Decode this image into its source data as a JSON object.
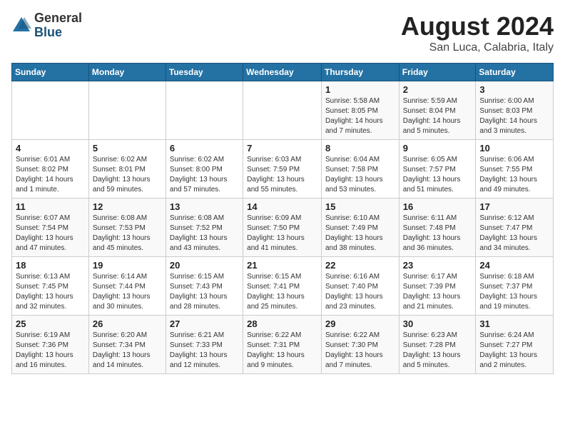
{
  "logo": {
    "general": "General",
    "blue": "Blue"
  },
  "title": "August 2024",
  "subtitle": "San Luca, Calabria, Italy",
  "days_of_week": [
    "Sunday",
    "Monday",
    "Tuesday",
    "Wednesday",
    "Thursday",
    "Friday",
    "Saturday"
  ],
  "weeks": [
    [
      {
        "day": "",
        "info": ""
      },
      {
        "day": "",
        "info": ""
      },
      {
        "day": "",
        "info": ""
      },
      {
        "day": "",
        "info": ""
      },
      {
        "day": "1",
        "info": "Sunrise: 5:58 AM\nSunset: 8:05 PM\nDaylight: 14 hours and 7 minutes."
      },
      {
        "day": "2",
        "info": "Sunrise: 5:59 AM\nSunset: 8:04 PM\nDaylight: 14 hours and 5 minutes."
      },
      {
        "day": "3",
        "info": "Sunrise: 6:00 AM\nSunset: 8:03 PM\nDaylight: 14 hours and 3 minutes."
      }
    ],
    [
      {
        "day": "4",
        "info": "Sunrise: 6:01 AM\nSunset: 8:02 PM\nDaylight: 14 hours and 1 minute."
      },
      {
        "day": "5",
        "info": "Sunrise: 6:02 AM\nSunset: 8:01 PM\nDaylight: 13 hours and 59 minutes."
      },
      {
        "day": "6",
        "info": "Sunrise: 6:02 AM\nSunset: 8:00 PM\nDaylight: 13 hours and 57 minutes."
      },
      {
        "day": "7",
        "info": "Sunrise: 6:03 AM\nSunset: 7:59 PM\nDaylight: 13 hours and 55 minutes."
      },
      {
        "day": "8",
        "info": "Sunrise: 6:04 AM\nSunset: 7:58 PM\nDaylight: 13 hours and 53 minutes."
      },
      {
        "day": "9",
        "info": "Sunrise: 6:05 AM\nSunset: 7:57 PM\nDaylight: 13 hours and 51 minutes."
      },
      {
        "day": "10",
        "info": "Sunrise: 6:06 AM\nSunset: 7:55 PM\nDaylight: 13 hours and 49 minutes."
      }
    ],
    [
      {
        "day": "11",
        "info": "Sunrise: 6:07 AM\nSunset: 7:54 PM\nDaylight: 13 hours and 47 minutes."
      },
      {
        "day": "12",
        "info": "Sunrise: 6:08 AM\nSunset: 7:53 PM\nDaylight: 13 hours and 45 minutes."
      },
      {
        "day": "13",
        "info": "Sunrise: 6:08 AM\nSunset: 7:52 PM\nDaylight: 13 hours and 43 minutes."
      },
      {
        "day": "14",
        "info": "Sunrise: 6:09 AM\nSunset: 7:50 PM\nDaylight: 13 hours and 41 minutes."
      },
      {
        "day": "15",
        "info": "Sunrise: 6:10 AM\nSunset: 7:49 PM\nDaylight: 13 hours and 38 minutes."
      },
      {
        "day": "16",
        "info": "Sunrise: 6:11 AM\nSunset: 7:48 PM\nDaylight: 13 hours and 36 minutes."
      },
      {
        "day": "17",
        "info": "Sunrise: 6:12 AM\nSunset: 7:47 PM\nDaylight: 13 hours and 34 minutes."
      }
    ],
    [
      {
        "day": "18",
        "info": "Sunrise: 6:13 AM\nSunset: 7:45 PM\nDaylight: 13 hours and 32 minutes."
      },
      {
        "day": "19",
        "info": "Sunrise: 6:14 AM\nSunset: 7:44 PM\nDaylight: 13 hours and 30 minutes."
      },
      {
        "day": "20",
        "info": "Sunrise: 6:15 AM\nSunset: 7:43 PM\nDaylight: 13 hours and 28 minutes."
      },
      {
        "day": "21",
        "info": "Sunrise: 6:15 AM\nSunset: 7:41 PM\nDaylight: 13 hours and 25 minutes."
      },
      {
        "day": "22",
        "info": "Sunrise: 6:16 AM\nSunset: 7:40 PM\nDaylight: 13 hours and 23 minutes."
      },
      {
        "day": "23",
        "info": "Sunrise: 6:17 AM\nSunset: 7:39 PM\nDaylight: 13 hours and 21 minutes."
      },
      {
        "day": "24",
        "info": "Sunrise: 6:18 AM\nSunset: 7:37 PM\nDaylight: 13 hours and 19 minutes."
      }
    ],
    [
      {
        "day": "25",
        "info": "Sunrise: 6:19 AM\nSunset: 7:36 PM\nDaylight: 13 hours and 16 minutes."
      },
      {
        "day": "26",
        "info": "Sunrise: 6:20 AM\nSunset: 7:34 PM\nDaylight: 13 hours and 14 minutes."
      },
      {
        "day": "27",
        "info": "Sunrise: 6:21 AM\nSunset: 7:33 PM\nDaylight: 13 hours and 12 minutes."
      },
      {
        "day": "28",
        "info": "Sunrise: 6:22 AM\nSunset: 7:31 PM\nDaylight: 13 hours and 9 minutes."
      },
      {
        "day": "29",
        "info": "Sunrise: 6:22 AM\nSunset: 7:30 PM\nDaylight: 13 hours and 7 minutes."
      },
      {
        "day": "30",
        "info": "Sunrise: 6:23 AM\nSunset: 7:28 PM\nDaylight: 13 hours and 5 minutes."
      },
      {
        "day": "31",
        "info": "Sunrise: 6:24 AM\nSunset: 7:27 PM\nDaylight: 13 hours and 2 minutes."
      }
    ]
  ]
}
